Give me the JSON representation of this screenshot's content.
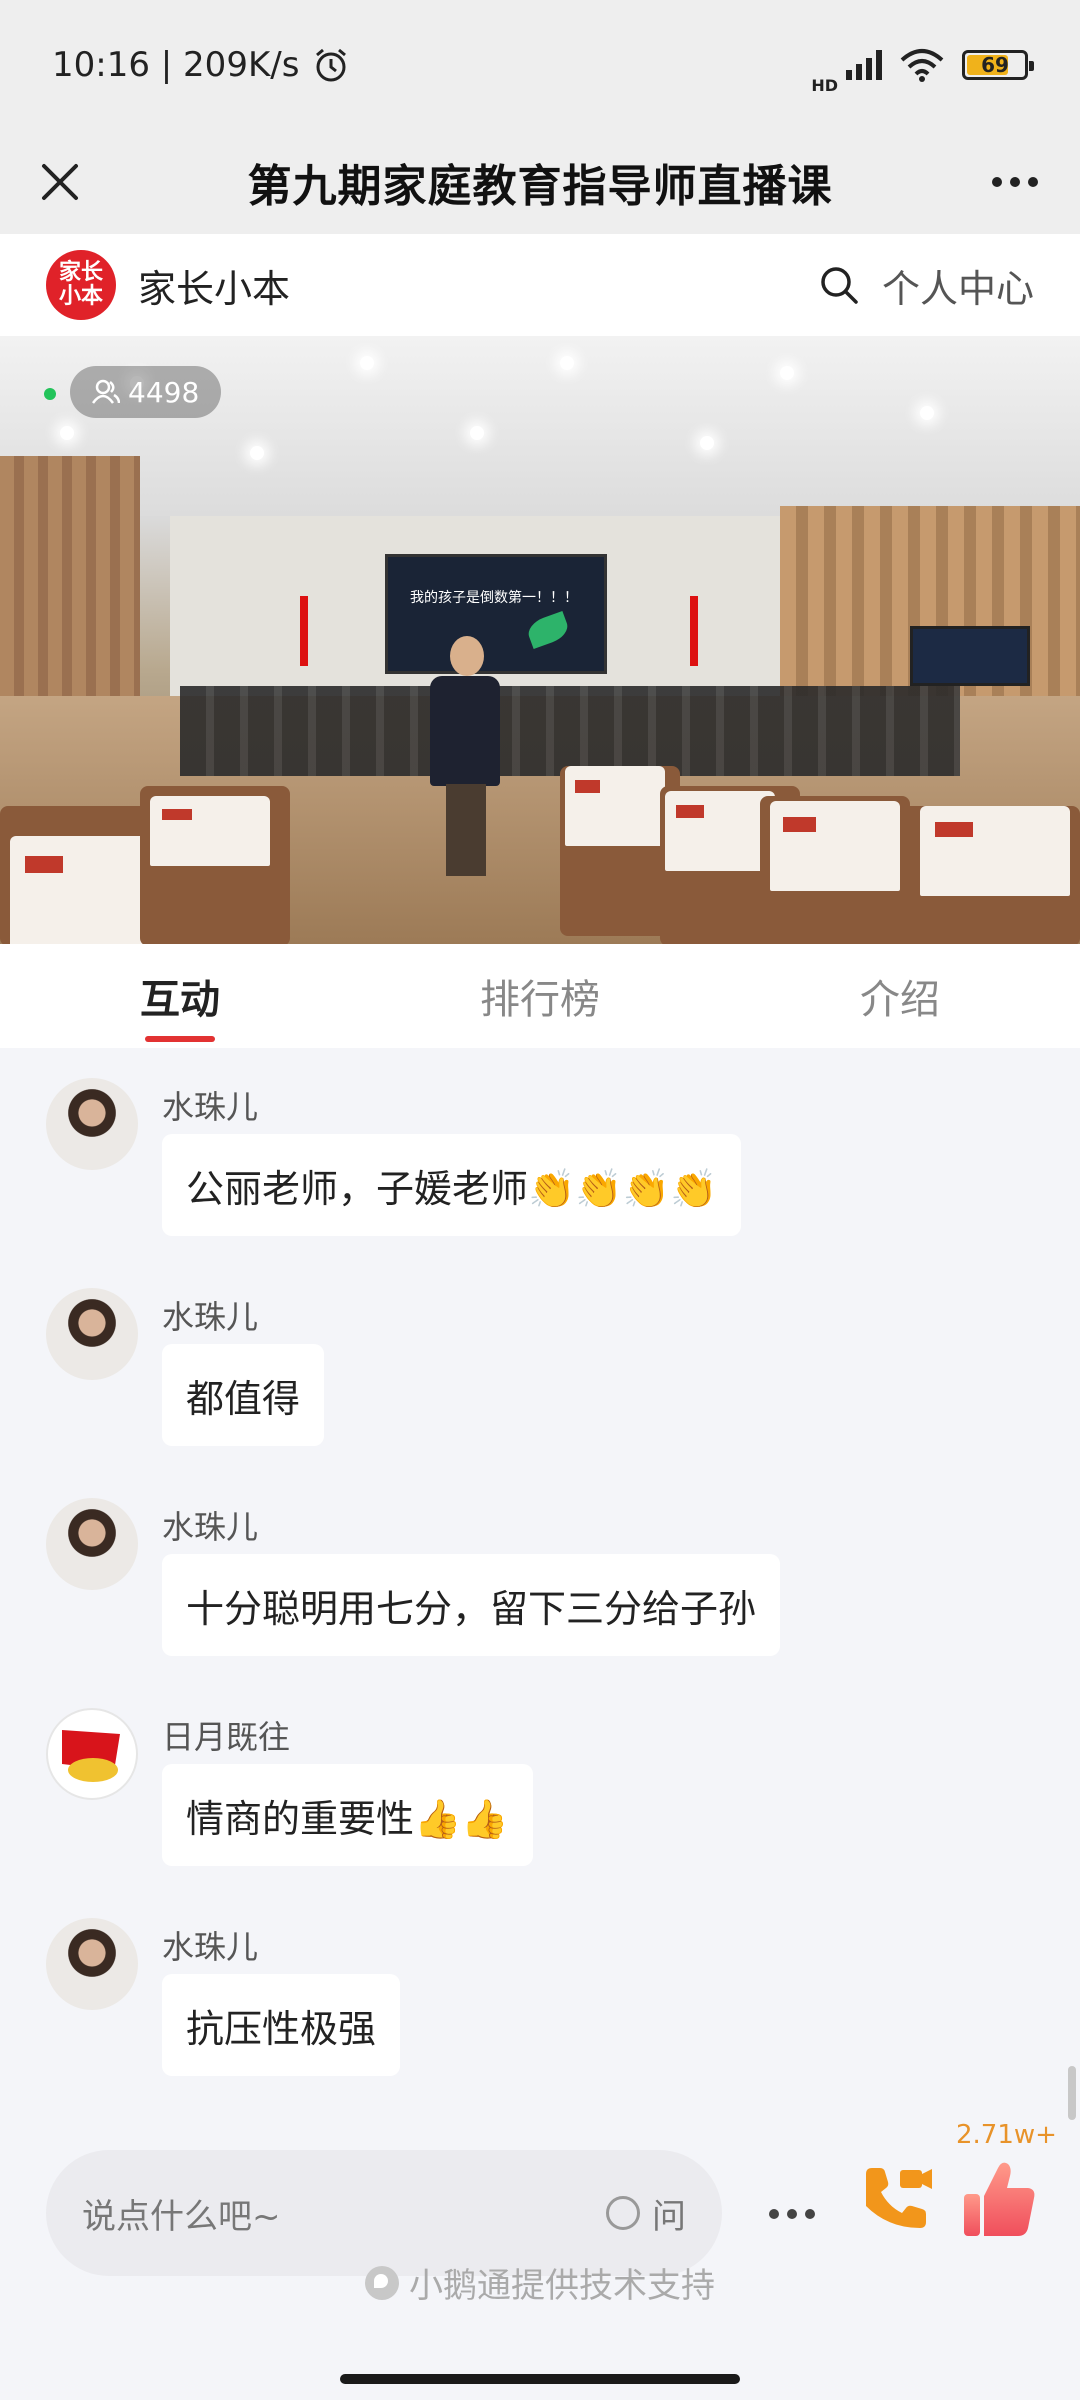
{
  "status_bar": {
    "time_speed": "10:16 | 209K/s",
    "network": "HD",
    "battery": "69"
  },
  "title_bar": {
    "title": "第九期家庭教育指导师直播课"
  },
  "brand": {
    "logo_text": "家长小本",
    "name": "家长小本",
    "personal_center": "个人中心"
  },
  "video": {
    "viewer_count": "4498",
    "screen_text": "我的孩子是倒数第一！！！"
  },
  "tabs": [
    {
      "label": "互动",
      "active": true
    },
    {
      "label": "排行榜",
      "active": false
    },
    {
      "label": "介绍",
      "active": false
    }
  ],
  "messages": [
    {
      "user": "水珠儿",
      "text": "公丽老师，子媛老师👏👏👏👏",
      "avatar": "portrait"
    },
    {
      "user": "水珠儿",
      "text": "都值得",
      "avatar": "portrait"
    },
    {
      "user": "水珠儿",
      "text": "十分聪明用七分，留下三分给子孙",
      "avatar": "portrait"
    },
    {
      "user": "日月既往",
      "text": "情商的重要性👍👍",
      "avatar": "party-flag"
    },
    {
      "user": "水珠儿",
      "text": "抗压性极强",
      "avatar": "portrait"
    }
  ],
  "input": {
    "placeholder": "说点什么吧~",
    "ask_label": "问"
  },
  "like_count": "2.71w+",
  "support_text": "小鹅通提供技术支持",
  "colors": {
    "accent_red": "#e23232",
    "brand_red": "#e02229",
    "like_orange": "#e8932a"
  }
}
